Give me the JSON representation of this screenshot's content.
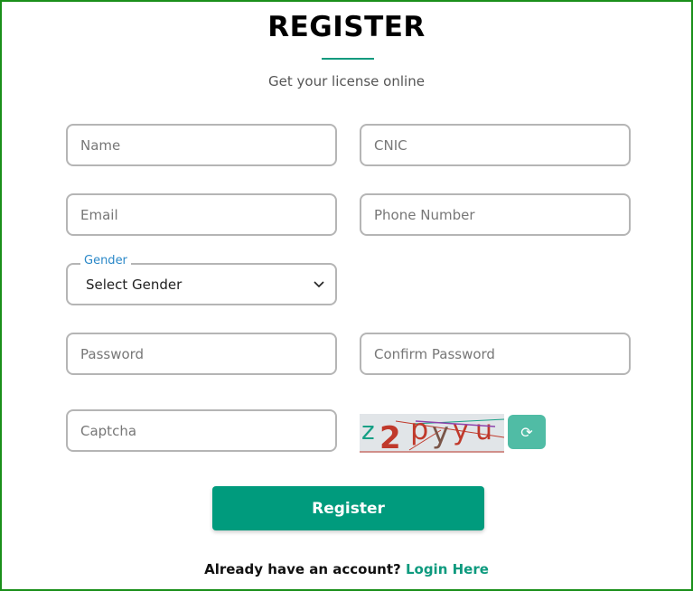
{
  "header": {
    "title": "REGISTER",
    "subtitle": "Get your license online"
  },
  "form": {
    "name_placeholder": "Name",
    "cnic_placeholder": "CNIC",
    "email_placeholder": "Email",
    "phone_placeholder": "Phone Number",
    "gender_label": "Gender",
    "gender_value": "Select Gender",
    "password_placeholder": "Password",
    "confirm_password_placeholder": "Confirm Password",
    "captcha_placeholder": "Captcha",
    "captcha_image_text": "z2pyyu",
    "submit_label": "Register"
  },
  "footer": {
    "prompt": "Already have an account?",
    "login_link": "Login Here"
  },
  "colors": {
    "accent": "#009b7d",
    "refresh": "#50bca5",
    "legend": "#2a88c8"
  },
  "icons": {
    "select": "chevron-down-icon",
    "refresh": "refresh-icon"
  }
}
